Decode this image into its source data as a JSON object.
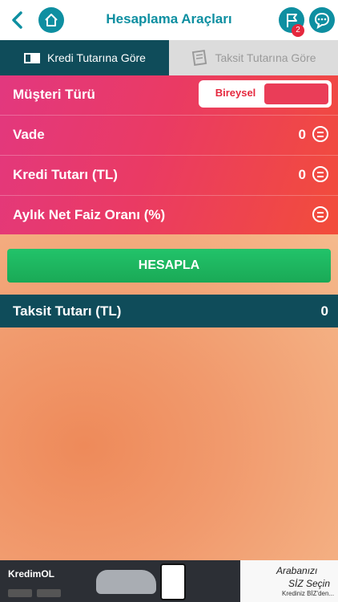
{
  "header": {
    "title": "Hesaplama Araçları",
    "notification_count": "2"
  },
  "tabs": [
    {
      "label": "Kredi Tutarına Göre",
      "active": true
    },
    {
      "label": "Taksit Tutarına Göre",
      "active": false
    }
  ],
  "form": {
    "customer_type": {
      "label": "Müşteri Türü",
      "value": "Bireysel"
    },
    "term": {
      "label": "Vade",
      "value": "0"
    },
    "loan_amount": {
      "label": "Kredi Tutarı (TL)",
      "value": "0"
    },
    "interest_rate": {
      "label": "Aylık Net Faiz Oranı (%)",
      "value": ""
    }
  },
  "calculate_button": {
    "label": "HESAPLA"
  },
  "result": {
    "label": "Taksit Tutarı (TL)",
    "value": "0"
  },
  "ad": {
    "brand": "KredimOL",
    "slogan_line1": "Arabanızı",
    "slogan_line2": "SİZ Seçin",
    "slogan_line3": "Krediniz BİZ'den..."
  },
  "colors": {
    "teal": "#0e8fa1",
    "dark_teal": "#0f4c5a",
    "pink_red": "#ea3a64",
    "green": "#1fb460",
    "badge_red": "#e5283e"
  },
  "icons": {
    "back": "chevron-left",
    "home": "home",
    "flag": "flag",
    "chat": "chat-bubble",
    "equals": "equals-circle"
  }
}
